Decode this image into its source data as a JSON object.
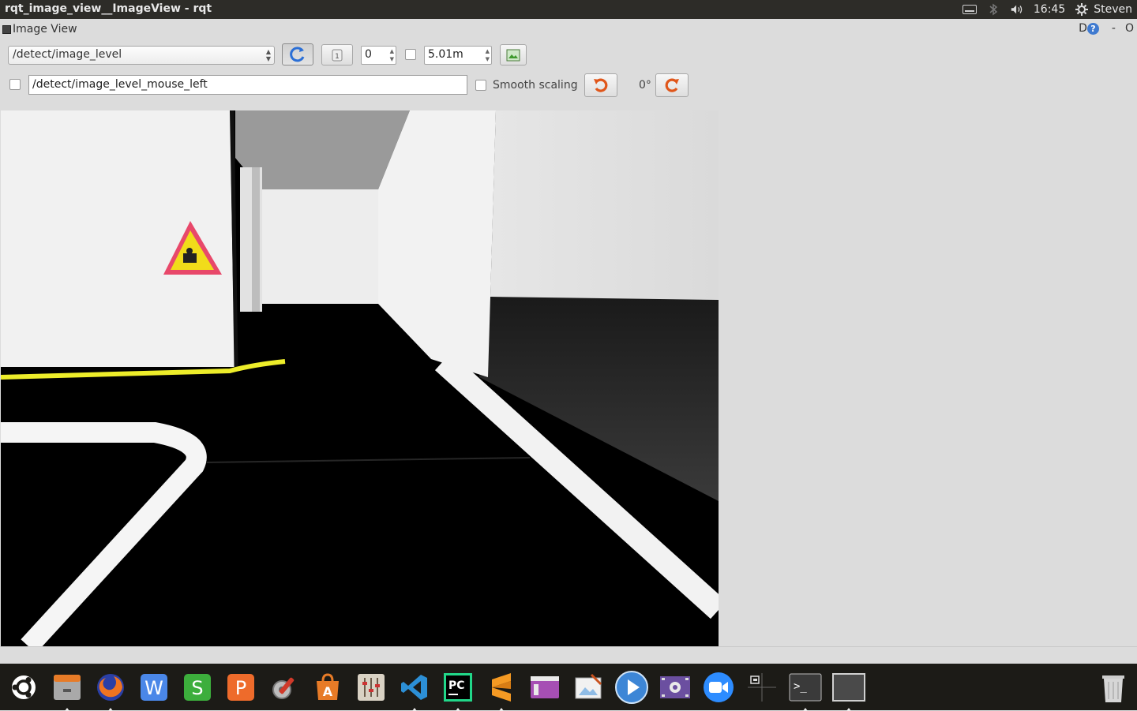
{
  "window": {
    "title": "rqt_image_view__ImageView - rqt"
  },
  "system": {
    "clock": "16:45",
    "user": "Steven"
  },
  "dock_header": {
    "label": "Image View",
    "help_prefix": "D",
    "help_mark": "?",
    "minimize": "-",
    "close": "O"
  },
  "controls": {
    "topic": "/detect/image_level",
    "zoom_value": "0",
    "max_age": "5.01m",
    "mouse_topic": "/detect/image_level_mouse_left",
    "smooth_scaling_label": "Smooth scaling",
    "rotation": "0°"
  },
  "launcher": {
    "apps": [
      "ubuntu-icon",
      "files-icon",
      "firefox-icon",
      "writer-icon",
      "spreadsheet-icon",
      "presentation-icon",
      "settings-icon",
      "software-center-icon",
      "mixer-icon",
      "vscode-icon",
      "pycharm-icon",
      "sublime-icon",
      "window-app-icon",
      "image-editor-icon",
      "media-player-icon",
      "video-editor-icon",
      "zoom-icon",
      "workspace-switcher-icon",
      "terminal-icon",
      "window-icon",
      "trash-icon"
    ],
    "terminal_glyph": ">_",
    "pycharm_label": "PC",
    "writer_label": "W",
    "spreadsheet_label": "S",
    "presentation_label": "P"
  },
  "colors": {
    "topbar": "#2d2c28",
    "dock": "#1c1b17",
    "accent": "#dd4814"
  }
}
